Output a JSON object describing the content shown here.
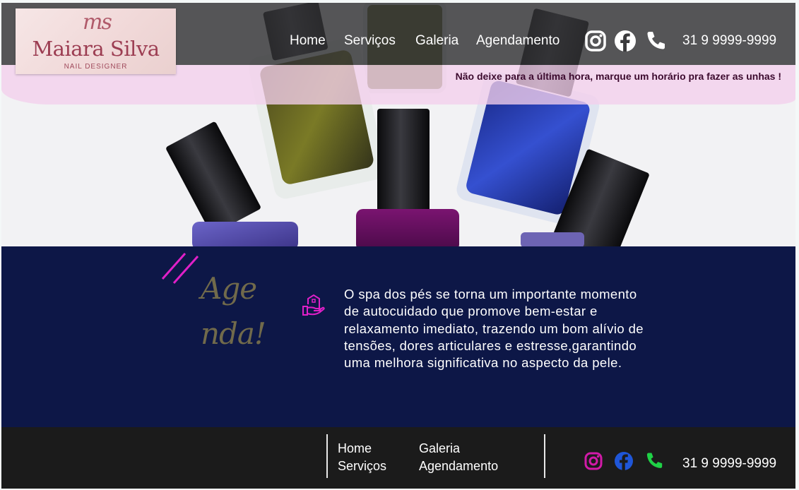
{
  "brand": {
    "monogram": "ms",
    "name": "Maiara Silva",
    "tagline": "NAIL DESIGNER"
  },
  "header": {
    "nav": [
      {
        "label": "Home"
      },
      {
        "label": "Serviços"
      },
      {
        "label": "Galeria"
      },
      {
        "label": "Agendamento"
      }
    ],
    "icons": [
      "instagram-icon",
      "facebook-icon",
      "phone-icon"
    ],
    "phone": "31 9 9999-9999",
    "promo": "Não deixe para a última hora, marque um horário pra fazer as unhas !"
  },
  "section": {
    "heading_line1": "Age",
    "heading_line2": "nda!",
    "icon": "hand-house-icon",
    "description": "O spa dos pés se torna um importante momento de autocuidado que promove bem-estar e relaxamento imediato, trazendo um bom alívio de tensões, dores articulares e estresse,garantindo uma melhora significativa no aspecto da pele."
  },
  "footer": {
    "links": [
      {
        "label": "Home"
      },
      {
        "label": "Serviços"
      },
      {
        "label": "Galeria"
      },
      {
        "label": "Agendamento"
      }
    ],
    "icons": [
      "instagram-icon",
      "facebook-icon",
      "phone-icon"
    ],
    "phone": "31 9 9999-9999"
  },
  "colors": {
    "header_bg": "#323234",
    "promo_band": "#f4d0ec",
    "section_bg": "#0d1747",
    "heading": "#716a4b",
    "accent_magenta": "#e020c8",
    "footer_bg": "#1b1b1b",
    "footer_instagram": "#d21aa8",
    "footer_facebook": "#1f56d8",
    "footer_phone": "#1fd146"
  }
}
